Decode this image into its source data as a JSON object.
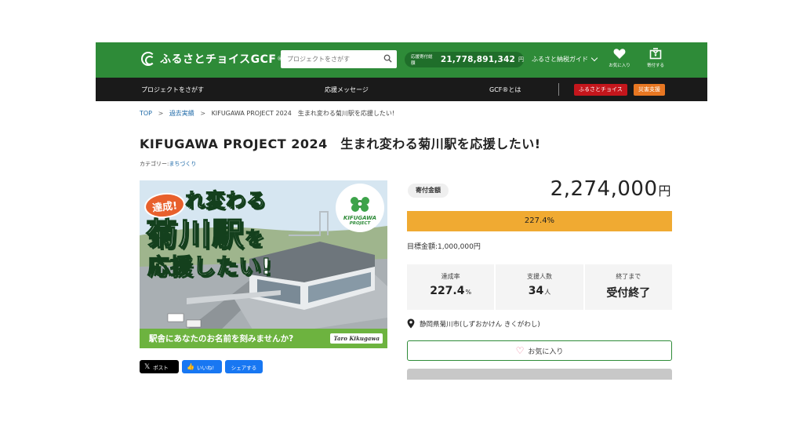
{
  "header": {
    "logo_text": "ふるさとチョイスGCF",
    "logo_tm": "®",
    "search_placeholder": "プロジェクトをさがす",
    "total_label": "応援寄付総額",
    "total_value": "21,778,891,342",
    "total_unit": "円",
    "guide_label": "ふるさと納税ガイド",
    "favorite_label": "お気に入り",
    "donate_label": "寄付する",
    "brand_color": "#2e8b38"
  },
  "nav": {
    "find_projects": "プロジェクトをさがす",
    "messages": "応援メッセージ",
    "about": "GCF®とは",
    "badge_choice": "ふるさとチョイス",
    "badge_disaster": "災害支援"
  },
  "breadcrumb": {
    "top": "TOP",
    "past": "過去実績",
    "current": "KIFUGAWA PROJECT 2024　生まれ変わる菊川駅を応援したい!"
  },
  "project": {
    "title": "KIFUGAWA PROJECT 2024　生まれ変わる菊川駅を応援したい!",
    "category_label": "カテゴリー:",
    "category_value": "まちづくり",
    "hero": {
      "achieved": "達成!",
      "line1": "れ変わる",
      "line2_main": "菊川駅",
      "line2_small": "を",
      "line3": "応援したい!",
      "logo_line1": "KIFUGAWA",
      "logo_line2": "PROJECT",
      "band_message": "駅舎にあなたのお名前を刻みませんか?",
      "signature": "Taro Kikugawa"
    },
    "share": {
      "x_label": "ポスト",
      "like_label": "いいね!",
      "share_label": "シェアする"
    },
    "donation_label": "寄付金額",
    "donation_amount": "2,274,000",
    "donation_unit": "円",
    "progress_text": "227.4%",
    "progress_ratio": 1.0,
    "goal": "目標金額:1,000,000円",
    "stats": [
      {
        "label": "達成率",
        "value": "227.4",
        "unit": "%"
      },
      {
        "label": "支援人数",
        "value": "34",
        "unit": "人"
      },
      {
        "label": "終了まで",
        "value": "受付終了",
        "unit": ""
      }
    ],
    "location": "静岡県菊川市(しずおかけん きくがわし)",
    "favorite_button": "お気に入り",
    "progress_color": "#f0aa32"
  }
}
